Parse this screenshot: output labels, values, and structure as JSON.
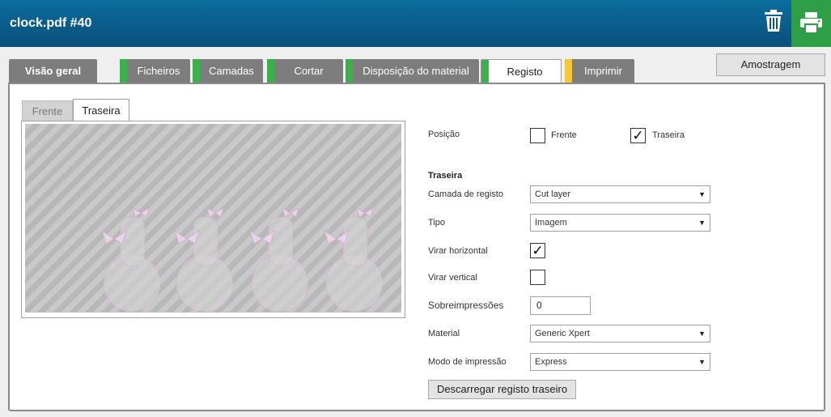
{
  "header": {
    "title": "clock.pdf #40"
  },
  "tabs": [
    {
      "label": "Visão geral"
    },
    {
      "label": "Ficheiros"
    },
    {
      "label": "Camadas"
    },
    {
      "label": "Cortar"
    },
    {
      "label": "Disposição do material"
    },
    {
      "label": "Registo"
    },
    {
      "label": "Imprimir"
    }
  ],
  "tab_marks": {
    "green": "#3cb04a",
    "yellow": "#f4c83a"
  },
  "sampling_label": "Amostragem",
  "subtabs": {
    "front": "Frente",
    "back": "Traseira"
  },
  "form": {
    "position_label": "Posição",
    "position_front": "Frente",
    "position_back": "Traseira",
    "section_title": "Traseira",
    "register_layer_label": "Camada de registo",
    "register_layer_value": "Cut layer",
    "type_label": "Tipo",
    "type_value": "Imagem",
    "flip_h_label": "Virar horizontal",
    "flip_v_label": "Virar vertical",
    "overprints_label": "Sobreimpressões",
    "overprints_value": "0",
    "material_label": "Material",
    "material_value": "Generic Xpert",
    "print_mode_label": "Modo de impressão",
    "print_mode_value": "Express",
    "download_label": "Descarregar registo traseiro"
  },
  "checks": {
    "position_front": false,
    "position_back": true,
    "flip_horizontal": true,
    "flip_vertical": false
  }
}
